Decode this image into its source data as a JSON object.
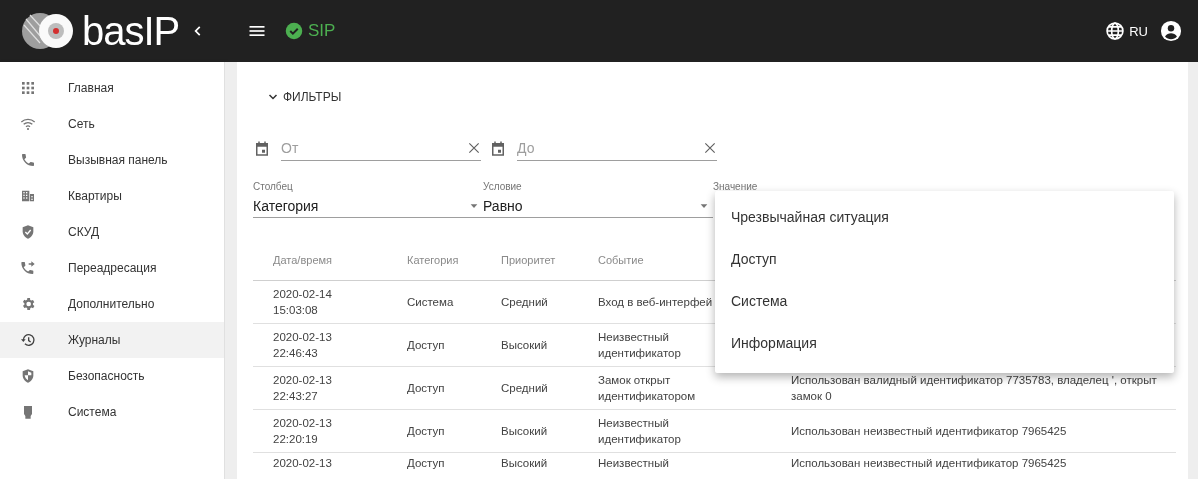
{
  "header": {
    "logo": "basIP",
    "sip": {
      "label": "SIP",
      "registered": true
    },
    "language": "RU"
  },
  "sidebar": {
    "items": [
      {
        "label": "Главная",
        "selected": false
      },
      {
        "label": "Сеть",
        "selected": false
      },
      {
        "label": "Вызывная панель",
        "selected": false
      },
      {
        "label": "Квартиры",
        "selected": false
      },
      {
        "label": "СКУД",
        "selected": false
      },
      {
        "label": "Переадресация",
        "selected": false
      },
      {
        "label": "Дополнительно",
        "selected": false
      },
      {
        "label": "Журналы",
        "selected": true
      },
      {
        "label": "Безопасность",
        "selected": false
      },
      {
        "label": "Система",
        "selected": false
      }
    ]
  },
  "filters": {
    "toggle": "ФИЛЬТРЫ",
    "expanded": true,
    "date_from": {
      "placeholder": "От"
    },
    "date_to": {
      "placeholder": "До"
    },
    "column": {
      "label": "Столбец",
      "value": "Категория"
    },
    "condition": {
      "label": "Условие",
      "value": "Равно"
    },
    "value": {
      "label": "Значение",
      "expanded": true,
      "options": [
        "Чрезвычайная ситуация",
        "Доступ",
        "Система",
        "Информация"
      ]
    }
  },
  "table": {
    "columns": [
      "Дата/время",
      "Категория",
      "Приоритет",
      "Событие"
    ],
    "rows": [
      {
        "datetime": "2020-02-14 15:03:08",
        "category": "Система",
        "priority": "Средний",
        "event": "Вход в веб-интерфей"
      },
      {
        "datetime": "2020-02-13 22:46:43",
        "category": "Доступ",
        "priority": "Высокий",
        "event": "Неизвестный идентификатор"
      },
      {
        "datetime": "2020-02-13 22:43:27",
        "category": "Доступ",
        "priority": "Средний",
        "event": "Замок открыт идентификатором",
        "description": "Использован валидный идентификатор 7735783, владелец ', открыт замок 0"
      },
      {
        "datetime": "2020-02-13 22:20:19",
        "category": "Доступ",
        "priority": "Высокий",
        "event": "Неизвестный идентификатор",
        "description": "Использован неизвестный идентификатор 7965425"
      },
      {
        "datetime": "2020-02-13",
        "category": "Доступ",
        "priority": "Высокий",
        "event": "Неизвестный",
        "description": "Использован неизвестный идентификатор 7965425"
      }
    ]
  }
}
